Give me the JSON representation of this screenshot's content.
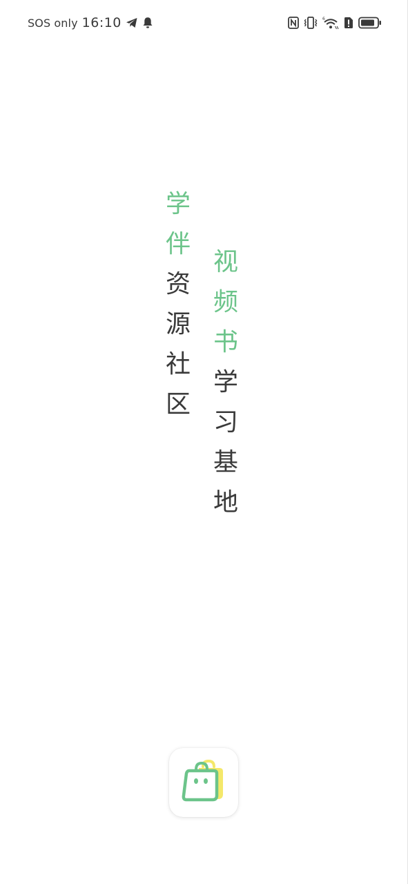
{
  "status_bar": {
    "carrier": "SOS only",
    "time": "16:10",
    "icons_left": [
      "telegram-icon",
      "bell-icon"
    ],
    "icons_right": [
      "nfc-icon",
      "vibrate-icon",
      "wifi-icon",
      "sim-alert-icon",
      "battery-icon"
    ]
  },
  "splash": {
    "column_left": [
      "学",
      "伴",
      "资",
      "源",
      "社",
      "区"
    ],
    "column_right": [
      "视",
      "频",
      "书",
      "学",
      "习",
      "基",
      "地"
    ],
    "accent_color": "#6cc48a",
    "text_color": "#3a3a3a"
  },
  "app_icon": {
    "name": "bag-icon",
    "colors": [
      "#6cc48a",
      "#f4e86a"
    ]
  }
}
